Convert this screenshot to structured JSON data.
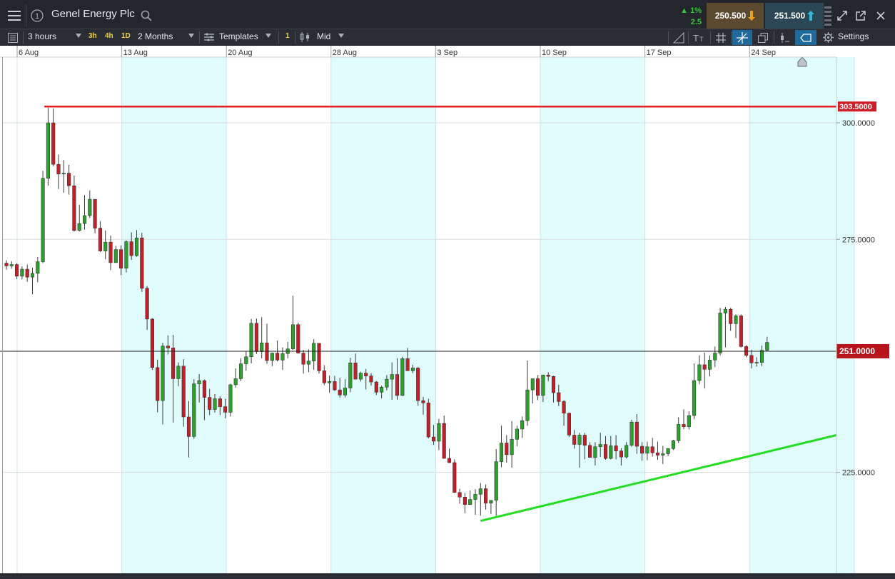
{
  "header": {
    "instrument": "Genel Energy Plc",
    "change_pct": "1%",
    "change_pts": "2.5",
    "sell_price": "250.500",
    "buy_price": "251.500"
  },
  "toolbar": {
    "interval": "3 hours",
    "quick_3h": "3h",
    "quick_4h": "4h",
    "quick_1d": "1D",
    "range": "2 Months",
    "templates": "Templates",
    "templates_count": "1",
    "price_type": "Mid",
    "settings": "Settings"
  },
  "chart_data": {
    "type": "candlestick",
    "x_tick_labels": [
      "6 Aug",
      "13 Aug",
      "20 Aug",
      "28 Aug",
      "3 Sep",
      "10 Sep",
      "17 Sep",
      "24 Sep"
    ],
    "y_tick_labels": [
      "300.0000",
      "275.0000",
      "225.0000"
    ],
    "y_ticks": [
      300,
      275,
      225
    ],
    "ylim": [
      203.2,
      314.1
    ],
    "current_price": 251.0,
    "current_price_label": "251.0000",
    "resistance_level": 303.5,
    "resistance_label": "303.5000",
    "support_line": {
      "start_index": 0,
      "start_value": 214.6,
      "end_value": 233.0
    },
    "colors": {
      "up": "#2e9e2e",
      "down": "#c0202a",
      "resistance": "#e02020",
      "support": "#22dd22",
      "shade": "#e0fcfd"
    },
    "candles_segment_a": [
      [
        269.9,
        270.5,
        268.5,
        269.3
      ],
      [
        269.3,
        270.3,
        268.7,
        269.6
      ],
      [
        269.6,
        269.9,
        266.5,
        267.1
      ],
      [
        267.1,
        269.2,
        266.4,
        268.6
      ],
      [
        268.6,
        269.6,
        265.9,
        266.9
      ],
      [
        266.9,
        268.9,
        263.2,
        267.7
      ],
      [
        267.7,
        271.2,
        265.8,
        270.2
      ],
      [
        270.2,
        289.7,
        269.9,
        288.1
      ],
      [
        288.1,
        303.2,
        286.5,
        300.0
      ],
      [
        300.0,
        303.1,
        290.7,
        291.1
      ],
      [
        291.1,
        293.2,
        285.8,
        289.0
      ],
      [
        289.0,
        292.0,
        285.0,
        289.2
      ],
      [
        289.2,
        291.0,
        284.6,
        286.5
      ],
      [
        286.5,
        288.7,
        276.7,
        276.9
      ],
      [
        276.9,
        282.4,
        276.7,
        278.4
      ],
      [
        278.4,
        284.5,
        277.1,
        280.1
      ],
      [
        280.1,
        285.5,
        279.6,
        283.6
      ],
      [
        283.6,
        283.6,
        276.3,
        277.4
      ],
      [
        277.4,
        278.9,
        272.3,
        272.5
      ],
      [
        272.5,
        276.9,
        270.7,
        274.4
      ],
      [
        274.4,
        275.8,
        268.4,
        270.0
      ],
      [
        270.0,
        273.6,
        270.0,
        272.8
      ],
      [
        272.8,
        273.7,
        267.3,
        268.8
      ],
      [
        268.8,
        274.8,
        267.9,
        274.5
      ],
      [
        274.5,
        276.5,
        270.6,
        271.5
      ],
      [
        271.5,
        277.0,
        271.3,
        275.3
      ],
      [
        275.3,
        276.4,
        263.7,
        264.5
      ],
      [
        264.5,
        265.0,
        255.6,
        257.9
      ],
      [
        257.9,
        258.1,
        247.0,
        247.5
      ],
      [
        247.5,
        249.2,
        237.9,
        240.4
      ],
      [
        240.4,
        252.8,
        235.3,
        252.1
      ],
      [
        252.1,
        254.4,
        250.3,
        251.7
      ],
      [
        251.7,
        254.5,
        235.7,
        245.1
      ],
      [
        245.1,
        248.6,
        243.5,
        247.8
      ],
      [
        247.8,
        249.3,
        234.8,
        236.9
      ],
      [
        236.9,
        240.3,
        228.2,
        232.7
      ],
      [
        232.7,
        245.0,
        232.2,
        244.0
      ],
      [
        244.0,
        246.1,
        240.0,
        244.7
      ],
      [
        244.7,
        244.9,
        236.2,
        241.1
      ],
      [
        241.1,
        242.9,
        237.3,
        238.5
      ],
      [
        238.5,
        241.8,
        237.8,
        240.8
      ],
      [
        240.8,
        241.3,
        237.3,
        239.1
      ],
      [
        239.1,
        240.8,
        236.6,
        237.9
      ],
      [
        237.9,
        244.0,
        237.0,
        243.8
      ],
      [
        243.8,
        247.3,
        243.2,
        245.1
      ],
      [
        245.1,
        249.5,
        244.6,
        248.3
      ],
      [
        248.3,
        250.9,
        246.8,
        249.8
      ],
      [
        249.8,
        257.9,
        248.4,
        257.0
      ],
      [
        257.0,
        258.0,
        250.4,
        250.9
      ],
      [
        250.9,
        258.3,
        249.5,
        252.8
      ]
    ],
    "candles_segment_b": [
      [
        252.8,
        256.9,
        248.3,
        249.0
      ],
      [
        249.0,
        250.7,
        247.8,
        250.6
      ],
      [
        250.6,
        253.3,
        248.8,
        249.1
      ],
      [
        249.1,
        251.8,
        247.0,
        250.5
      ],
      [
        250.5,
        253.0,
        249.5,
        251.5
      ],
      [
        251.5,
        262.9,
        251.3,
        256.7
      ],
      [
        256.7,
        257.1,
        250.5,
        250.6
      ],
      [
        250.6,
        251.3,
        246.2,
        248.2
      ],
      [
        248.2,
        251.4,
        246.5,
        248.9
      ],
      [
        248.9,
        253.6,
        247.0,
        252.7
      ],
      [
        252.7,
        252.7,
        246.2,
        246.8
      ],
      [
        246.8,
        248.0,
        243.7,
        244.2
      ],
      [
        244.2,
        245.8,
        242.1,
        244.5
      ],
      [
        244.5,
        245.7,
        242.5,
        242.7
      ],
      [
        242.7,
        245.3,
        241.0,
        241.6
      ],
      [
        241.6,
        245.0,
        241.1,
        243.1
      ],
      [
        243.1,
        249.6,
        242.2,
        248.5
      ],
      [
        248.5,
        250.5,
        246.8,
        245.0
      ],
      [
        245.0,
        246.6,
        244.5,
        246.3
      ],
      [
        246.3,
        247.2,
        242.8,
        245.7
      ],
      [
        245.7,
        246.3,
        243.6,
        244.4
      ],
      [
        244.4,
        244.6,
        241.6,
        242.2
      ],
      [
        242.2,
        243.6,
        240.9,
        243.3
      ],
      [
        243.3,
        245.9,
        242.6,
        245.0
      ],
      [
        245.0,
        248.6,
        240.6,
        246.0
      ],
      [
        246.0,
        249.5,
        240.6,
        241.5
      ],
      [
        241.5,
        249.8,
        241.4,
        249.4
      ],
      [
        249.4,
        251.7,
        248.5,
        246.8
      ],
      [
        246.8,
        248.1,
        246.3,
        247.4
      ],
      [
        247.4,
        247.6,
        239.3,
        240.4
      ],
      [
        240.4,
        241.2,
        237.4,
        239.9
      ],
      [
        239.9,
        240.8,
        232.3,
        232.6
      ],
      [
        232.6,
        235.2,
        230.9,
        231.7
      ],
      [
        231.7,
        236.5,
        229.8,
        235.5
      ],
      [
        235.5,
        237.2,
        229.9,
        228.0
      ],
      [
        228.0,
        230.1,
        227.0,
        227.1
      ],
      [
        227.1,
        227.8,
        220.6,
        220.7
      ],
      [
        220.7,
        221.5,
        218.3,
        219.7
      ],
      [
        219.7,
        220.6,
        216.2,
        218.1
      ],
      [
        218.1,
        221.1,
        218.0,
        219.2
      ],
      [
        219.2,
        221.4,
        215.9,
        220.3
      ],
      [
        220.3,
        222.7,
        215.7,
        221.5
      ],
      [
        221.5,
        222.4,
        217.0,
        218.4
      ],
      [
        218.4,
        218.5,
        216.1,
        219.0
      ],
      [
        219.0,
        230.0,
        215.7,
        227.3
      ],
      [
        227.3,
        235.0,
        226.1,
        231.3
      ],
      [
        231.3,
        233.0,
        227.1,
        228.8
      ],
      [
        228.8,
        236.0,
        226.0,
        232.1
      ],
      [
        232.1,
        235.0,
        230.6,
        234.3
      ],
      [
        234.3,
        237.0,
        232.4,
        236.1
      ],
      [
        236.1,
        249.0,
        235.0,
        242.7
      ],
      [
        242.7,
        244.2,
        239.8,
        245.1
      ]
    ],
    "candles_segment_c": [
      [
        245.1,
        245.9,
        240.5,
        241.5
      ],
      [
        241.5,
        244.5,
        240.1,
        245.9
      ],
      [
        245.9,
        246.5,
        244.6,
        245.6
      ],
      [
        245.6,
        245.7,
        240.0,
        242.1
      ],
      [
        242.1,
        243.8,
        239.2,
        240.2
      ],
      [
        240.2,
        240.5,
        235.0,
        237.7
      ],
      [
        237.7,
        237.8,
        232.6,
        233.0
      ],
      [
        233.0,
        234.1,
        230.1,
        231.0
      ],
      [
        231.0,
        233.5,
        226.0,
        233.0
      ],
      [
        233.0,
        233.5,
        227.8,
        230.8
      ],
      [
        230.8,
        231.5,
        228.7,
        228.2
      ],
      [
        228.2,
        231.5,
        226.5,
        230.5
      ],
      [
        230.5,
        233.5,
        228.3,
        231.0
      ],
      [
        231.0,
        232.8,
        227.7,
        228.0
      ],
      [
        228.0,
        232.8,
        227.8,
        230.7
      ],
      [
        230.7,
        233.0,
        227.8,
        229.6
      ],
      [
        229.6,
        230.2,
        226.5,
        228.3
      ],
      [
        228.3,
        231.5,
        228.0,
        230.8
      ],
      [
        230.8,
        236.3,
        230.5,
        235.8
      ],
      [
        235.8,
        237.5,
        229.0,
        230.6
      ],
      [
        230.6,
        231.5,
        227.5,
        229.1
      ],
      [
        229.1,
        231.6,
        227.6,
        230.5
      ],
      [
        230.5,
        232.4,
        228.4,
        229.2
      ],
      [
        229.2,
        231.6,
        227.7,
        228.7
      ],
      [
        228.7,
        230.7,
        226.8,
        229.0
      ],
      [
        229.0,
        230.2,
        228.5,
        230.1
      ],
      [
        230.1,
        232.0,
        229.8,
        231.8
      ],
      [
        231.8,
        236.8,
        231.3,
        235.3
      ],
      [
        235.3,
        238.5,
        234.3,
        234.8
      ],
      [
        234.8,
        238.1,
        234.2,
        237.2
      ],
      [
        237.2,
        248.4,
        236.4,
        244.7
      ],
      [
        244.7,
        250.1,
        243.9,
        248.1
      ],
      [
        248.1,
        250.7,
        243.0,
        247.1
      ],
      [
        247.1,
        250.1,
        245.6,
        249.1
      ],
      [
        249.1,
        252.0,
        247.6,
        250.6
      ],
      [
        250.6,
        260.3,
        250.1,
        259.2
      ],
      [
        259.2,
        260.5,
        251.8,
        260.0
      ],
      [
        260.0,
        260.3,
        255.4,
        256.9
      ],
      [
        256.9,
        258.9,
        253.8,
        258.6
      ],
      [
        258.6,
        258.9,
        251.8,
        252.0
      ],
      [
        252.0,
        252.3,
        249.7,
        250.1
      ],
      [
        250.1,
        251.3,
        247.3,
        248.5
      ],
      [
        248.5,
        249.7,
        247.7,
        248.6
      ],
      [
        248.6,
        252.2,
        247.8,
        251.2
      ],
      [
        251.2,
        254.1,
        251.0,
        252.9
      ]
    ]
  }
}
